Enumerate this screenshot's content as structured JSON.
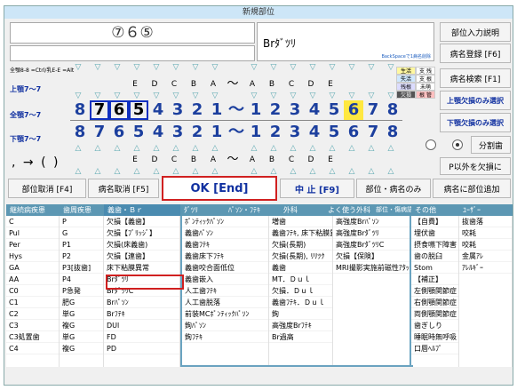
{
  "window_title": "新規部位",
  "teeth_selection_display": "⑦６⑤",
  "diagnosis_display": "Brﾀﾞﾂﾘ",
  "hint_text": "BackSpaceで1病名削除",
  "buttons": {
    "site_input_help": "部位入力説明",
    "register_disease": "病名登録 [F6]",
    "search_disease": "病名検索 [F1]",
    "upper_missing_only": "上顎欠損のみ選択",
    "lower_missing_only": "下顎欠損のみ選択",
    "split_tooth": "分割歯",
    "p_missing": "P以外を欠損に",
    "site_cancel": "部位取消 [F4]",
    "disease_cancel": "病名取消 [F5]",
    "ok": "OK [End]",
    "abort": "中 止 [F9]",
    "site_disease_only": "部位・病名のみ",
    "add_to_site": "病名に部位追加"
  },
  "shortcut_hint": "全顎8-8 =Ctrl/乳E-E =Alt",
  "jaw_labels": {
    "upper": "上顎7～7",
    "full": "全顎7～7",
    "lower": "下顎7～7"
  },
  "legend": {
    "a": "生活",
    "b": "支 残",
    "c": "失活",
    "d": "支 根",
    "e": "残根",
    "f": "未萌",
    "g": "欠損",
    "h": "根 管"
  },
  "upper_letters": [
    "E",
    "D",
    "C",
    "B",
    "A",
    "",
    "A",
    "B",
    "C",
    "D",
    "E"
  ],
  "tilde": "～",
  "upper_teeth": [
    "8",
    "7",
    "6",
    "5",
    "4",
    "3",
    "2",
    "1",
    "～",
    "1",
    "2",
    "3",
    "4",
    "5",
    "6",
    "7",
    "8"
  ],
  "lower_teeth": [
    "8",
    "7",
    "6",
    "5",
    "4",
    "3",
    "2",
    "1",
    "～",
    "1",
    "2",
    "3",
    "4",
    "5",
    "6",
    "7",
    "8"
  ],
  "lower_letters": [
    "E",
    "D",
    "C",
    "B",
    "A",
    "",
    "A",
    "B",
    "C",
    "D",
    "E"
  ],
  "punct": ",  →  ( )",
  "grid_headers": [
    "継続病疾患",
    "歯周疾患",
    "義歯・Ｂｒ",
    "ﾀﾞﾂﾘ",
    "ﾊﾟｿﾝ・ﾌﾃｷ",
    "外科",
    "よく使う外科",
    "部位・傷病語",
    "その他",
    "ﾕｰｻﾞｰ"
  ],
  "col1": [
    "C",
    "Pul",
    "Per",
    "Hys",
    "GA",
    "AA",
    "C0",
    "C1",
    "C2",
    "C3",
    "C3処置歯",
    "C4"
  ],
  "col2": [
    "P",
    "G",
    "P1",
    "P2",
    "P3[抜歯]",
    "P4",
    "P急発",
    "肥G",
    "単G",
    "複G",
    "単G",
    "複G"
  ],
  "col3": [
    "欠損【義歯】",
    "欠損【ﾌﾞﾘｯｼﾞ】",
    "欠損(床義歯)",
    "欠損【連歯】",
    "床下粘膜異常",
    "Brﾀﾞﾂﾘ",
    "BrﾀﾞﾂﾘC",
    "Brﾊﾟｿﾝ",
    "Brﾌﾃｷ",
    "DUl",
    "FD",
    "PD"
  ],
  "col4": [
    "ﾎﾟﾝﾃｨｯｸﾊﾟｿﾝ",
    "義歯ﾊﾟｿﾝ",
    "義歯ﾌﾃｷ",
    "義歯床下ﾌﾃｷ",
    "義歯咬合面低位",
    "義歯嵌入",
    "人工歯ﾌﾃｷ",
    "人工歯脱落",
    "前装MCﾎﾟﾝﾃｨｯｸﾊﾟｿﾝ",
    "鉤ﾊﾟｿﾝ",
    "鉤ﾌﾃｷ"
  ],
  "col5": [
    "増歯",
    "義歯ﾌﾃｷ, 床下粘膜異常",
    "欠損(長期)",
    "欠損(長期), ﾘﾘﾂｸ",
    "義歯",
    "MT．Ｄｕｌ",
    "欠損．Ｄｕｌ",
    "義歯ﾌﾃｷ．Ｄｕｌ",
    "鉤",
    "高強度Brﾌﾃｷ",
    "Br過高"
  ],
  "col6": [
    "高強度Brﾊﾟｿﾝ",
    "高強度Brﾀﾞﾂﾘ",
    "高強度BrﾀﾞﾂﾘC",
    "欠損【保険】",
    "MRI撮影実施前磁性ｱﾀｯ"
  ],
  "col7": [
    "【自費】",
    "埋伏歯",
    "摂食嚥下障害",
    "歯の脱臼",
    "Stom",
    "【補正】",
    "左側顎関節症",
    "右側顎関節症",
    "両側顎関節症",
    "歯ぎしり",
    "睡眠時無呼吸",
    "口唇ﾍﾙﾌﾟ"
  ],
  "col8": [
    "抜歯落",
    "咬耗",
    "咬耗",
    "金属ｱﾚ",
    "ｱﾚﾙｷﾞｰ"
  ]
}
